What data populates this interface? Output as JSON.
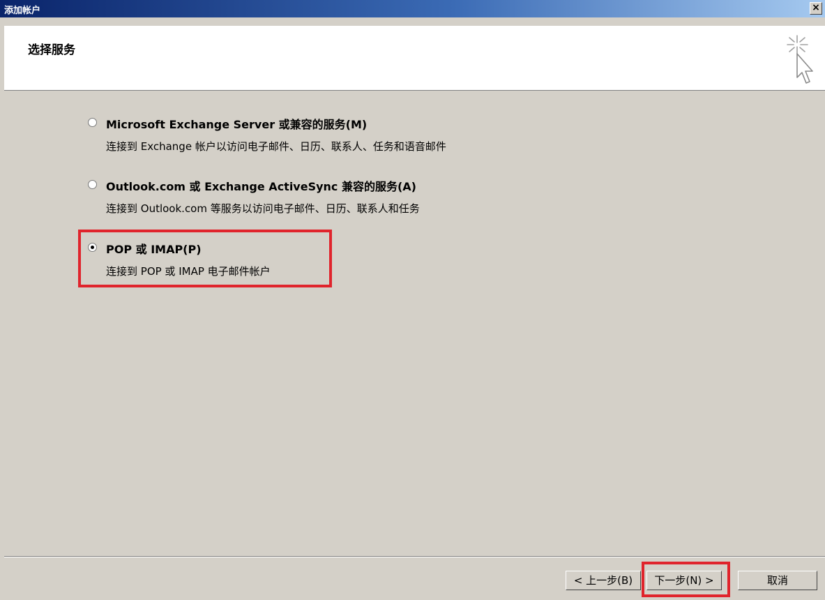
{
  "window": {
    "title": "添加帐户",
    "close_label": "×"
  },
  "header": {
    "title": "选择服务",
    "icon": "wizard-cursor-icon"
  },
  "options": [
    {
      "label": "Microsoft Exchange Server 或兼容的服务(M)",
      "description": "连接到 Exchange 帐户以访问电子邮件、日历、联系人、任务和语音邮件",
      "selected": false
    },
    {
      "label": "Outlook.com 或 Exchange ActiveSync 兼容的服务(A)",
      "description": "连接到 Outlook.com 等服务以访问电子邮件、日历、联系人和任务",
      "selected": false
    },
    {
      "label": "POP 或 IMAP(P)",
      "description": "连接到 POP 或 IMAP 电子邮件帐户",
      "selected": true
    }
  ],
  "buttons": {
    "back": "< 上一步(B)",
    "next": "下一步(N) >",
    "cancel": "取消"
  },
  "colors": {
    "highlight": "#e0242c",
    "dialog_bg": "#d4d0c8",
    "titlebar_start": "#0a246a"
  }
}
